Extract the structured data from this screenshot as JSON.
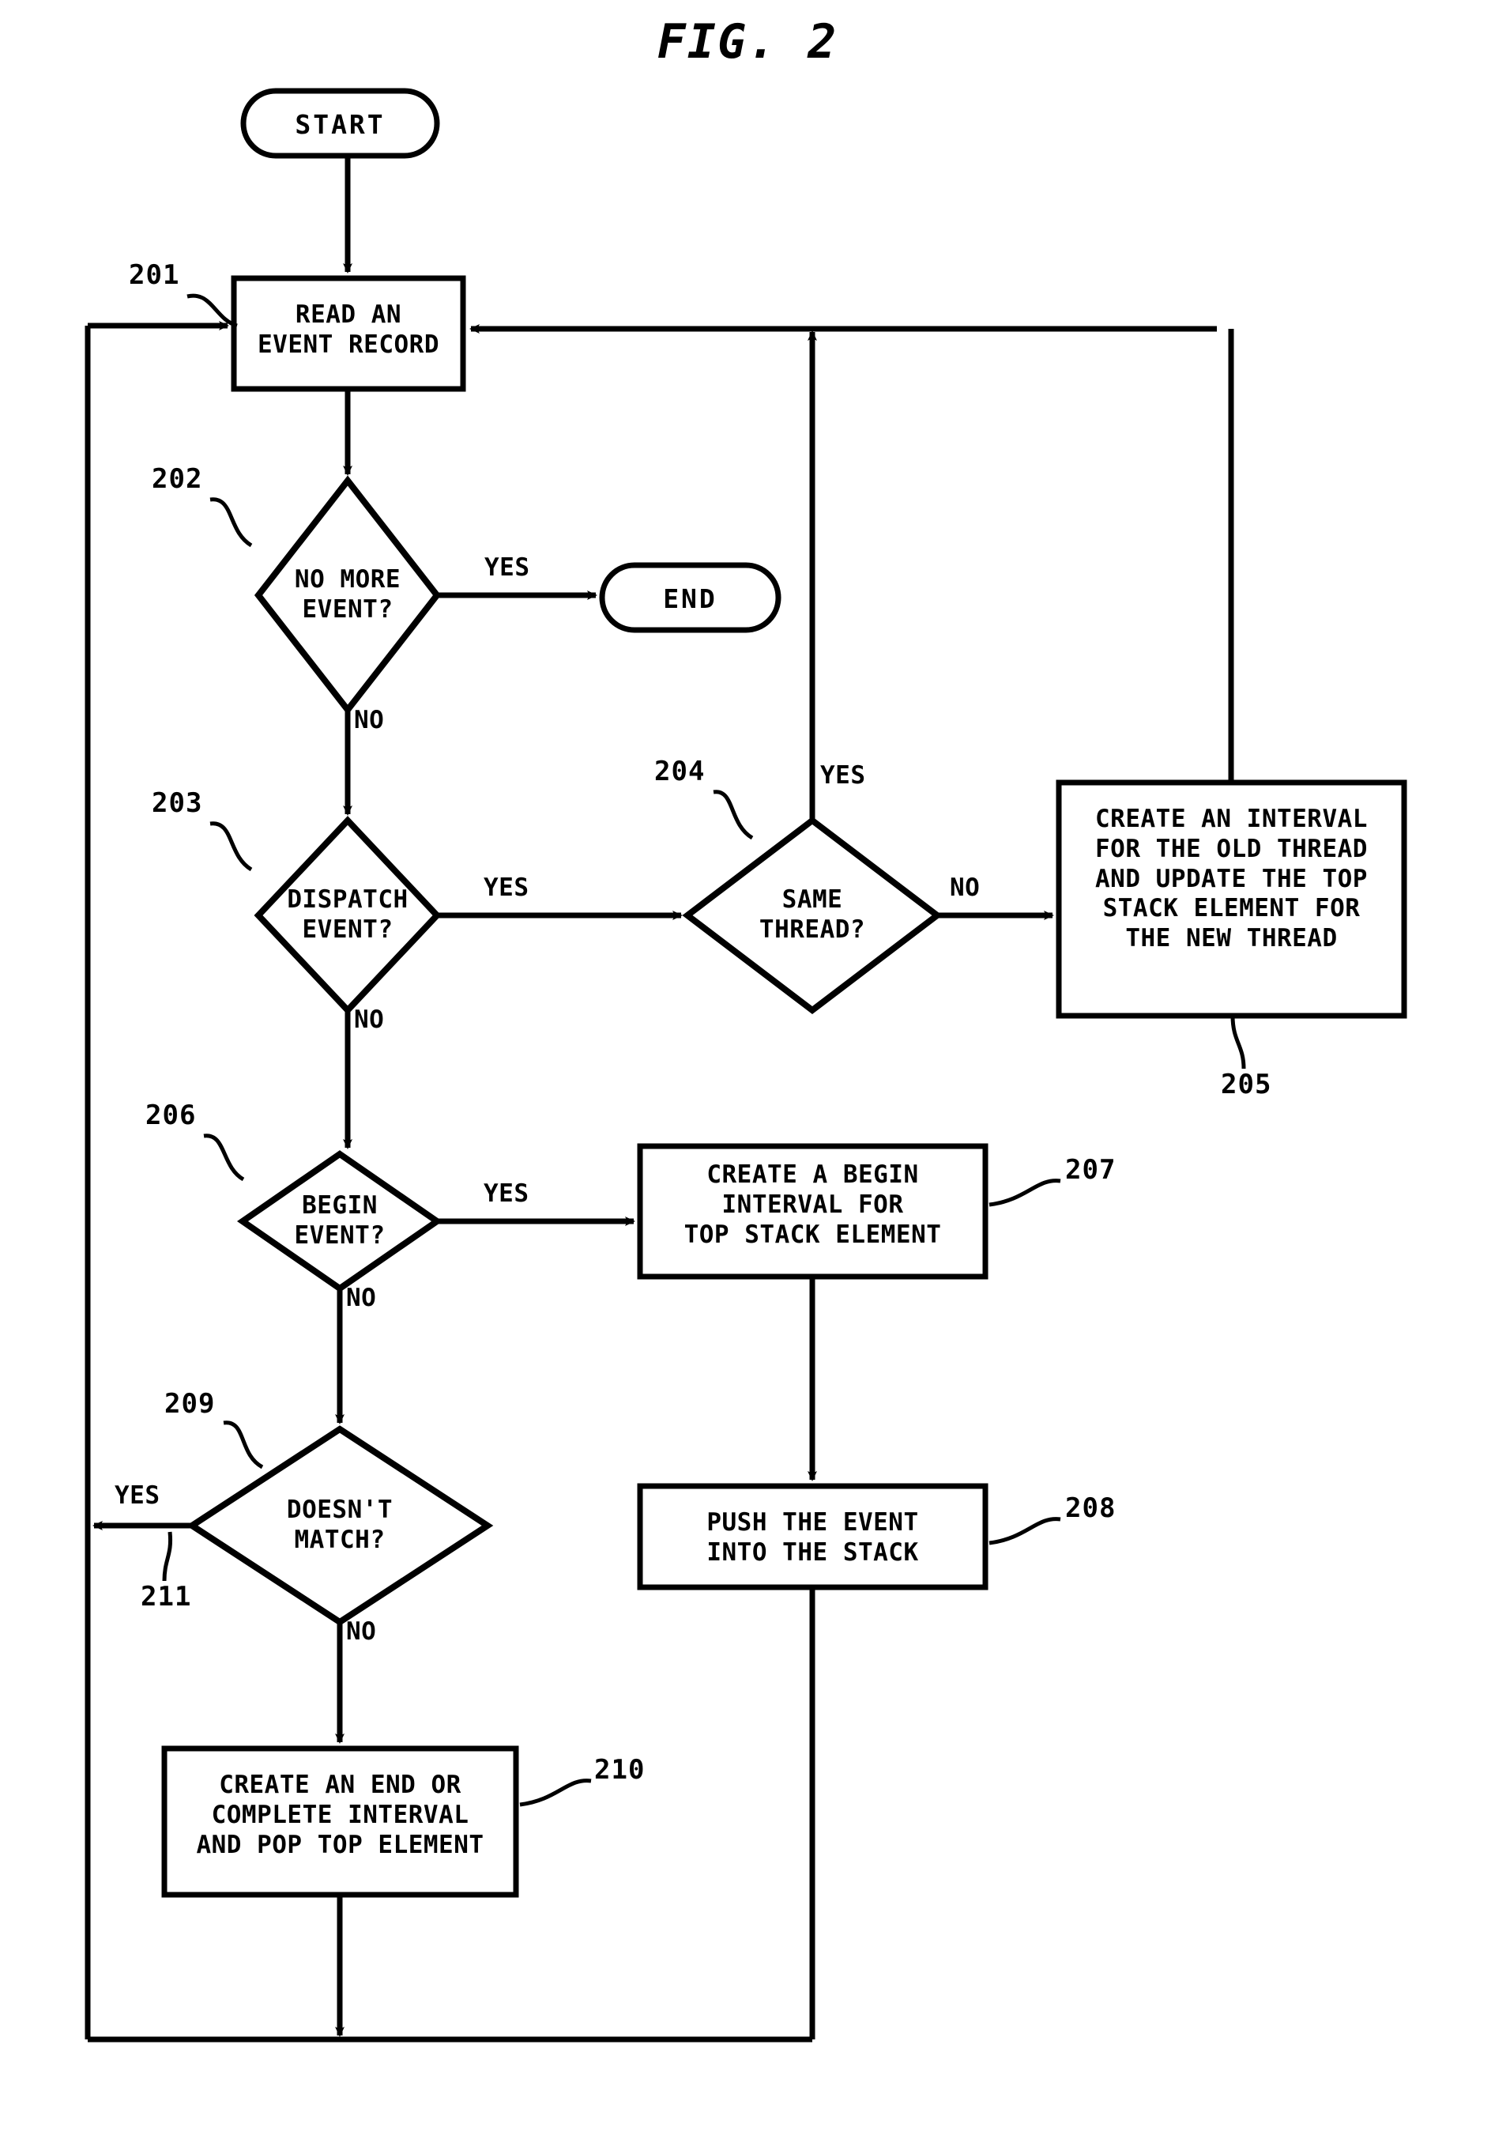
{
  "figure": {
    "title": "FIG. 2",
    "type": "flowchart"
  },
  "nodes": {
    "start": {
      "label": "START",
      "shape": "terminal"
    },
    "end": {
      "label": "END",
      "shape": "terminal"
    },
    "n201": {
      "ref": "201",
      "label": "READ AN\nEVENT RECORD",
      "shape": "process"
    },
    "n202": {
      "ref": "202",
      "label": "NO MORE\nEVENT?",
      "shape": "decision"
    },
    "n203": {
      "ref": "203",
      "label": "DISPATCH\nEVENT?",
      "shape": "decision"
    },
    "n204": {
      "ref": "204",
      "label": "SAME\nTHREAD?",
      "shape": "decision"
    },
    "n205": {
      "ref": "205",
      "label": "CREATE AN INTERVAL\nFOR THE OLD THREAD\nAND UPDATE THE TOP\nSTACK ELEMENT FOR\nTHE NEW THREAD",
      "shape": "process"
    },
    "n206": {
      "ref": "206",
      "label": "BEGIN\nEVENT?",
      "shape": "decision"
    },
    "n207": {
      "ref": "207",
      "label": "CREATE A BEGIN\nINTERVAL FOR\nTOP STACK ELEMENT",
      "shape": "process"
    },
    "n208": {
      "ref": "208",
      "label": "PUSH THE EVENT\nINTO THE STACK",
      "shape": "process"
    },
    "n209": {
      "ref": "209",
      "label": "DOESN'T\nMATCH?",
      "shape": "decision"
    },
    "n210": {
      "ref": "210",
      "label": "CREATE AN END OR\nCOMPLETE INTERVAL\nAND POP TOP ELEMENT",
      "shape": "process"
    }
  },
  "edge_labels": {
    "e202_yes": "YES",
    "e202_no": "NO",
    "e203_yes": "YES",
    "e203_no": "NO",
    "e204_yes": "YES",
    "e204_no": "NO",
    "e206_yes": "YES",
    "e206_no": "NO",
    "e209_yes": "YES",
    "e209_no": "NO"
  },
  "ref_labels": {
    "r201": "201",
    "r202": "202",
    "r203": "203",
    "r204": "204",
    "r205": "205",
    "r206": "206",
    "r207": "207",
    "r208": "208",
    "r209": "209",
    "r210": "210",
    "r211": "211"
  },
  "colors": {
    "stroke": "#000000",
    "background": "#ffffff"
  }
}
